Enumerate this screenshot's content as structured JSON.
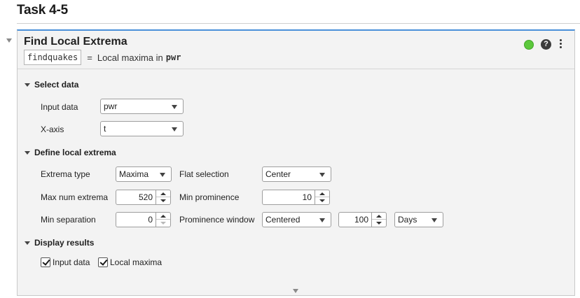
{
  "page": {
    "title": "Task 4-5"
  },
  "task": {
    "name": "Find Local Extrema",
    "function_name": "findquakes",
    "equals": "=",
    "summary_text": "Local maxima in",
    "summary_var": "pwr",
    "status_color": "#5cc83c",
    "help_glyph": "?"
  },
  "sections": {
    "select_data": {
      "title": "Select data",
      "input_data_label": "Input data",
      "input_data_value": "pwr",
      "x_axis_label": "X-axis",
      "x_axis_value": "t"
    },
    "define_extrema": {
      "title": "Define local extrema",
      "extrema_type_label": "Extrema type",
      "extrema_type_value": "Maxima",
      "flat_selection_label": "Flat selection",
      "flat_selection_value": "Center",
      "max_num_label": "Max num extrema",
      "max_num_value": "520",
      "min_prominence_label": "Min prominence",
      "min_prominence_value": "10",
      "min_separation_label": "Min separation",
      "min_separation_value": "0",
      "prominence_window_label": "Prominence window",
      "prominence_window_value": "Centered",
      "window_size_value": "100",
      "window_units_value": "Days"
    },
    "display_results": {
      "title": "Display results",
      "input_data_checkbox": "Input data",
      "input_data_checked": true,
      "local_maxima_checkbox": "Local maxima",
      "local_maxima_checked": true
    }
  }
}
